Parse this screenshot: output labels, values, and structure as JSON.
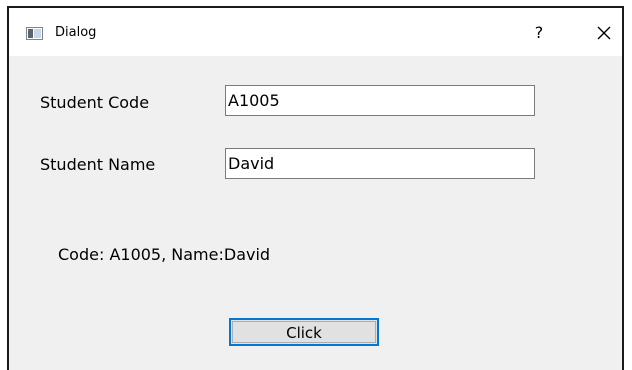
{
  "window": {
    "title": "Dialog",
    "help_label": "?",
    "icons": {
      "app": "window-icon",
      "close": "close-icon"
    }
  },
  "form": {
    "code_label": "Student Code",
    "code_value": "A1005",
    "name_label": "Student Name",
    "name_value": "David"
  },
  "result": {
    "text": "Code: A1005, Name:David"
  },
  "actions": {
    "click_label": "Click"
  },
  "colors": {
    "window_bg": "#f0f0f0",
    "titlebar_bg": "#ffffff",
    "button_focus_border": "#0078d7",
    "button_bg": "#e1e1e1"
  }
}
